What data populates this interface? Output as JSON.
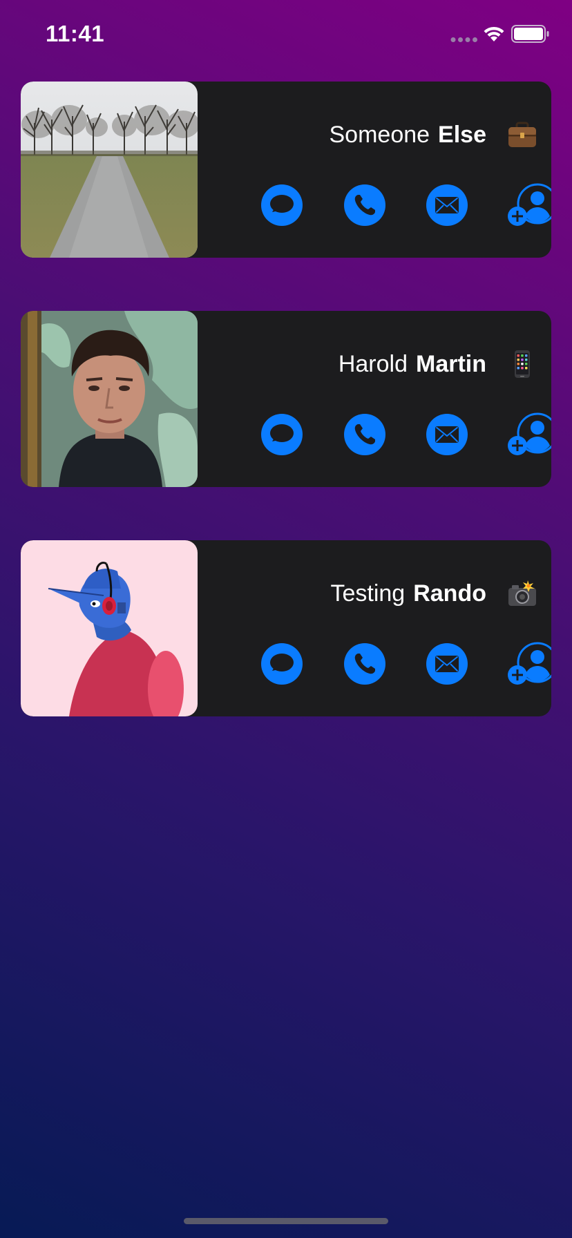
{
  "status_bar": {
    "time": "11:41",
    "signal_icon": "cellular-dots-icon",
    "wifi_icon": "wifi-icon",
    "battery_icon": "battery-full-icon"
  },
  "contacts": [
    {
      "first_name": "Someone",
      "last_name": "Else",
      "type_icon": "briefcase-icon",
      "photo": "tree-lined-path-photo",
      "actions": [
        "message",
        "phone",
        "mail",
        "add-contact"
      ]
    },
    {
      "first_name": "Harold",
      "last_name": "Martin",
      "type_icon": "mobile-phone-icon",
      "photo": "man-portrait-photo",
      "actions": [
        "message",
        "phone",
        "mail",
        "add-contact"
      ]
    },
    {
      "first_name": "Testing",
      "last_name": "Rando",
      "type_icon": "camera-flash-icon",
      "photo": "illustrated-person-photo",
      "actions": [
        "message",
        "phone",
        "mail",
        "add-contact"
      ]
    }
  ],
  "colors": {
    "accent": "#0a7cff",
    "card": "#1c1c1e",
    "gradient_top": "#7f0083",
    "gradient_bottom": "#071a55"
  }
}
